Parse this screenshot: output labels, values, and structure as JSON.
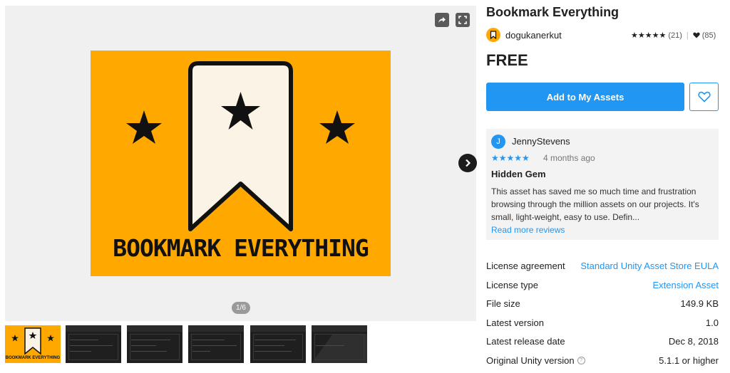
{
  "gallery": {
    "hero_caption": "BOOKMARK EVERYTHING",
    "counter": "1/6",
    "thumbnail_captions": [
      "BOOKMARK EVERYTHING"
    ],
    "share_icon": "share-icon",
    "fullscreen_icon": "fullscreen-icon",
    "next_icon": "chevron-right-icon"
  },
  "product": {
    "title": "Bookmark Everything",
    "publisher": "dogukanerkut",
    "stars": "★★★★★",
    "rating_count": "(21)",
    "favorites_count": "(85)",
    "price": "FREE"
  },
  "actions": {
    "add_label": "Add to My Assets",
    "favorite_icon": "heart-icon"
  },
  "review": {
    "avatar_letter": "J",
    "user": "JennyStevens",
    "stars": "★★★★★",
    "time": "4 months ago",
    "title": "Hidden Gem",
    "body": "This asset has saved me so much time and frustration browsing through the million assets on our projects. It's small, light-weight, easy to use. Defin...",
    "read_more": "Read more reviews"
  },
  "details": [
    {
      "label": "License agreement",
      "value": "Standard Unity Asset Store EULA",
      "link": true
    },
    {
      "label": "License type",
      "value": "Extension Asset",
      "link": true
    },
    {
      "label": "File size",
      "value": "149.9 KB",
      "link": false
    },
    {
      "label": "Latest version",
      "value": "1.0",
      "link": false
    },
    {
      "label": "Latest release date",
      "value": "Dec 8, 2018",
      "link": false
    },
    {
      "label": "Original Unity version",
      "value": "5.1.1 or higher",
      "link": false,
      "help": true
    }
  ],
  "colors": {
    "accent": "#2196f3",
    "brand_orange": "#ffa800",
    "ribbon": "#fbf3e6"
  }
}
